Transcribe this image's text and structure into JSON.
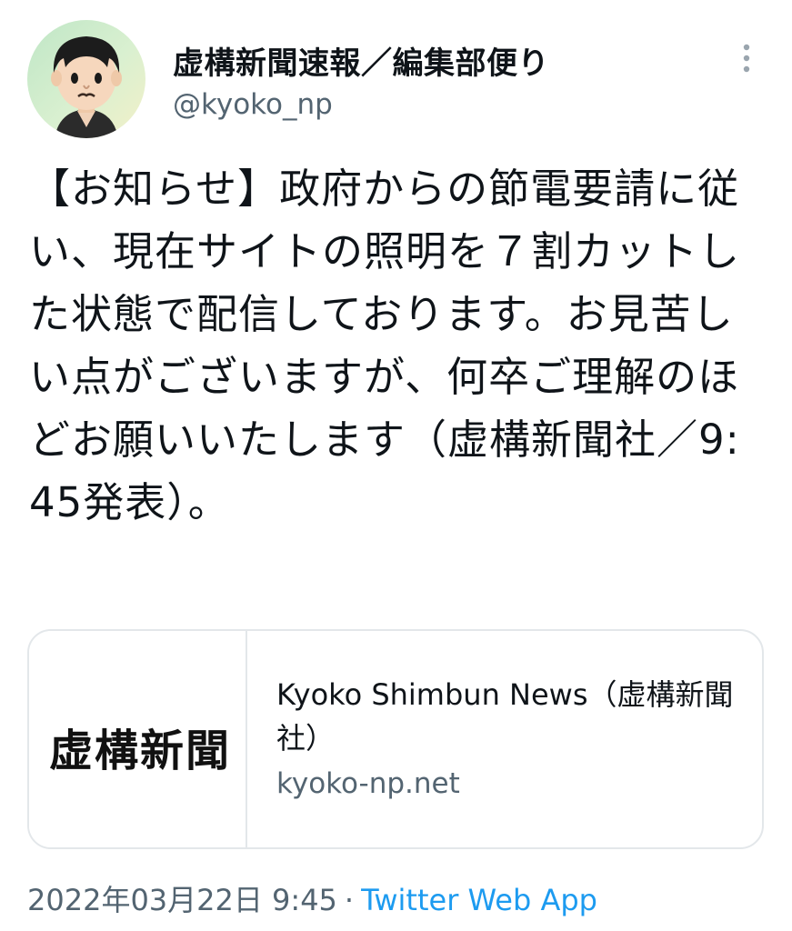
{
  "author": {
    "name": "虚構新聞速報／編集部便り",
    "handle": "@kyoko_np"
  },
  "icons": {
    "more": "more-vertical-icon",
    "avatar": "mii-avatar"
  },
  "tweet": {
    "text": "【お知らせ】政府からの節電要請に従い、現在サイトの照明を７割カットした状態で配信しております。お見苦しい点がございますが、何卒ご理解のほどお願いいたします（虚構新聞社／9:45発表）。"
  },
  "card": {
    "logo_text": "虚構新聞",
    "title": "Kyoko Shimbun News（虚構新聞社）",
    "domain": "kyoko-np.net"
  },
  "meta": {
    "timestamp": "2022年03月22日 9:45",
    "separator": "·",
    "source": "Twitter Web App"
  },
  "colors": {
    "text": "#0f1419",
    "secondary": "#536471",
    "link": "#1d9bf0",
    "border": "#e3e7ea"
  }
}
